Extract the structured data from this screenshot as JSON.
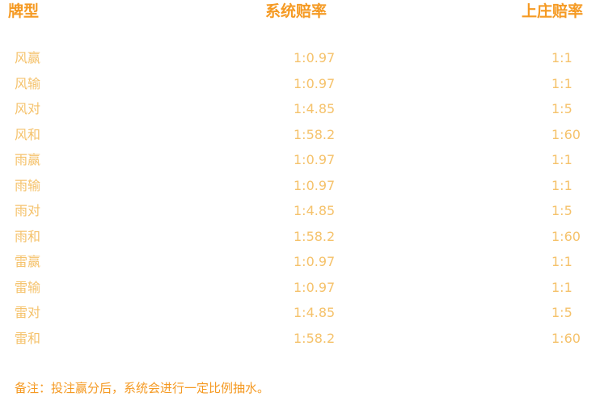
{
  "colors": {
    "header": "#f59a23",
    "row": "#f5c26b",
    "note": "#f59a23"
  },
  "header": {
    "type_label": "牌型",
    "system_label": "系统赔率",
    "banker_label": "上庄赔率"
  },
  "rows": [
    {
      "type": "风赢",
      "system": "1:0.97",
      "banker": "1:1"
    },
    {
      "type": "风输",
      "system": "1:0.97",
      "banker": "1:1"
    },
    {
      "type": "风对",
      "system": "1:4.85",
      "banker": "1:5"
    },
    {
      "type": "风和",
      "system": "1:58.2",
      "banker": "1:60"
    },
    {
      "type": "雨赢",
      "system": "1:0.97",
      "banker": "1:1"
    },
    {
      "type": "雨输",
      "system": "1:0.97",
      "banker": "1:1"
    },
    {
      "type": "雨对",
      "system": "1:4.85",
      "banker": "1:5"
    },
    {
      "type": "雨和",
      "system": "1:58.2",
      "banker": "1:60"
    },
    {
      "type": "雷赢",
      "system": "1:0.97",
      "banker": "1:1"
    },
    {
      "type": "雷输",
      "system": "1:0.97",
      "banker": "1:1"
    },
    {
      "type": "雷对",
      "system": "1:4.85",
      "banker": "1:5"
    },
    {
      "type": "雷和",
      "system": "1:58.2",
      "banker": "1:60"
    }
  ],
  "note": "备注：投注赢分后，系统会进行一定比例抽水。"
}
